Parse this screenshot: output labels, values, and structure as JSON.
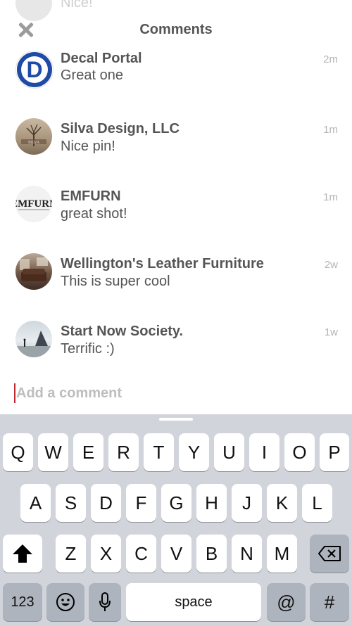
{
  "header": {
    "title": "Comments"
  },
  "ghost_comment": {
    "text": "Nice!"
  },
  "comments": [
    {
      "name": "Decal Portal",
      "text": "Great one",
      "time": "2m",
      "avatar_text": "D"
    },
    {
      "name": "Silva Design, LLC",
      "text": "Nice pin!",
      "time": "1m",
      "avatar_text": "SILVA"
    },
    {
      "name": "EMFURN",
      "text": "great shot!",
      "time": "1m",
      "avatar_text": "EMFURN"
    },
    {
      "name": "Wellington's Leather Furniture",
      "text": "This is super cool",
      "time": "2w"
    },
    {
      "name": "Start Now Society.",
      "text": "Terrific :)",
      "time": "1w"
    }
  ],
  "add_comment": {
    "placeholder": "Add a comment"
  },
  "keyboard": {
    "row1": [
      "Q",
      "W",
      "E",
      "R",
      "T",
      "Y",
      "U",
      "I",
      "O",
      "P"
    ],
    "row2": [
      "A",
      "S",
      "D",
      "F",
      "G",
      "H",
      "J",
      "K",
      "L"
    ],
    "row3": [
      "Z",
      "X",
      "C",
      "V",
      "B",
      "N",
      "M"
    ],
    "numbers_label": "123",
    "space_label": "space",
    "at_label": "@",
    "hash_label": "#"
  },
  "icons": {
    "close": "close-icon",
    "shift": "shift-icon",
    "backspace": "backspace-icon",
    "emoji": "emoji-icon",
    "mic": "mic-icon"
  },
  "colors": {
    "caret": "#c0262d",
    "keyboard_bg": "#d1d5db"
  }
}
